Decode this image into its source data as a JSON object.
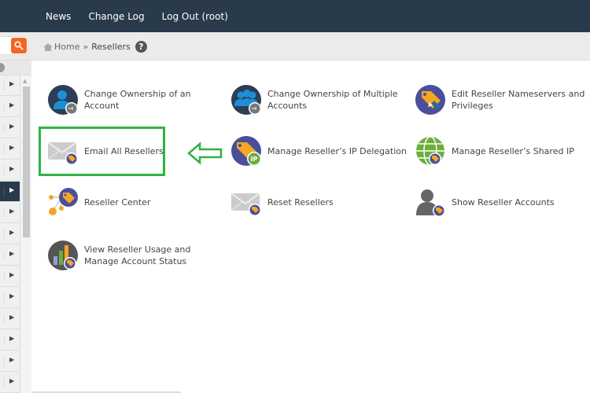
{
  "topnav": {
    "items": [
      "News",
      "Change Log",
      "Log Out (root)"
    ]
  },
  "search": {
    "icon": "search-icon"
  },
  "breadcrumb": {
    "home": "Home",
    "separator": "»",
    "current": "Resellers",
    "help": "?"
  },
  "sidebar": {
    "active_index": 5,
    "row_count": 15
  },
  "items": [
    {
      "label": "Change Ownership of an Account",
      "icon": "user-key-icon"
    },
    {
      "label": "Change Ownership of Multiple Accounts",
      "icon": "users-key-icon"
    },
    {
      "label": "Edit Reseller Nameservers and Privileges",
      "icon": "tag-pen-icon"
    },
    {
      "label": "Email All Resellers",
      "icon": "envelope-tag-icon"
    },
    {
      "label": "Manage Reseller’s IP Delegation",
      "icon": "tag-ip-icon",
      "badge": "IP"
    },
    {
      "label": "Manage Reseller’s Shared IP",
      "icon": "globe-tag-icon"
    },
    {
      "label": "Reseller Center",
      "icon": "network-tag-icon"
    },
    {
      "label": "Reset Resellers",
      "icon": "envelope-tag-icon"
    },
    {
      "label": "Show Reseller Accounts",
      "icon": "person-tag-icon"
    },
    {
      "label": "View Reseller Usage and Manage Account Status",
      "icon": "chart-tag-icon"
    }
  ],
  "annotation": {
    "highlight_color": "#2fb344",
    "highlighted_item": "Email All Resellers"
  },
  "colors": {
    "topbar": "#293a4a",
    "search_button": "#f26722",
    "icon_navy": "#2b3e54",
    "icon_blue": "#1e8fd6",
    "icon_purple": "#4a4f9a",
    "icon_orange": "#f5a623",
    "icon_green": "#6cae3e"
  }
}
